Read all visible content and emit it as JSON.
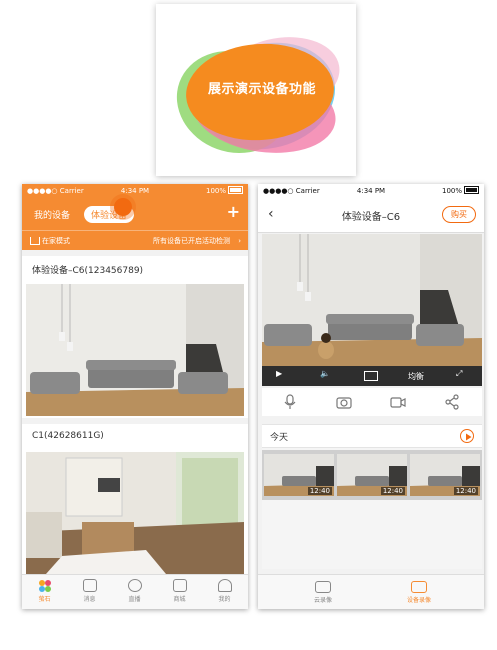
{
  "banner": {
    "title": "展示演示设备功能",
    "colors": {
      "orange": "#f58b1f",
      "blue": "#5cc6ec",
      "green": "#8ed66b",
      "pink": "#f27aa8"
    }
  },
  "phone1": {
    "status": {
      "carrier": "●●●●○ Carrier",
      "time": "4:34 PM",
      "battery": "100%"
    },
    "tabs": [
      "我的设备",
      "体验设备"
    ],
    "add_label": "+",
    "mode_label": "在家模式",
    "mode_status": "所有设备已开启活动检测",
    "mode_chevron": "›",
    "devices": [
      {
        "title": "体验设备–C6(123456789)"
      },
      {
        "title": "C1(42628611G)"
      }
    ],
    "nav": [
      "萤石",
      "消息",
      "直播",
      "商城",
      "我的"
    ],
    "colors": {
      "header": "#f58b32"
    }
  },
  "phone2": {
    "status": {
      "carrier": "●●●●○ Carrier",
      "time": "4:34 PM",
      "battery": "100%"
    },
    "back_label": "‹",
    "title": "体验设备–C6",
    "buy_label": "购买",
    "controls": {
      "quality": "均衡"
    },
    "today_label": "今天",
    "thumbs": [
      {
        "time": "12:40"
      },
      {
        "time": "12:40"
      },
      {
        "time": "12:40"
      }
    ],
    "nav": [
      "云录像",
      "设备录像"
    ],
    "colors": {
      "accent": "#f26a10"
    }
  }
}
